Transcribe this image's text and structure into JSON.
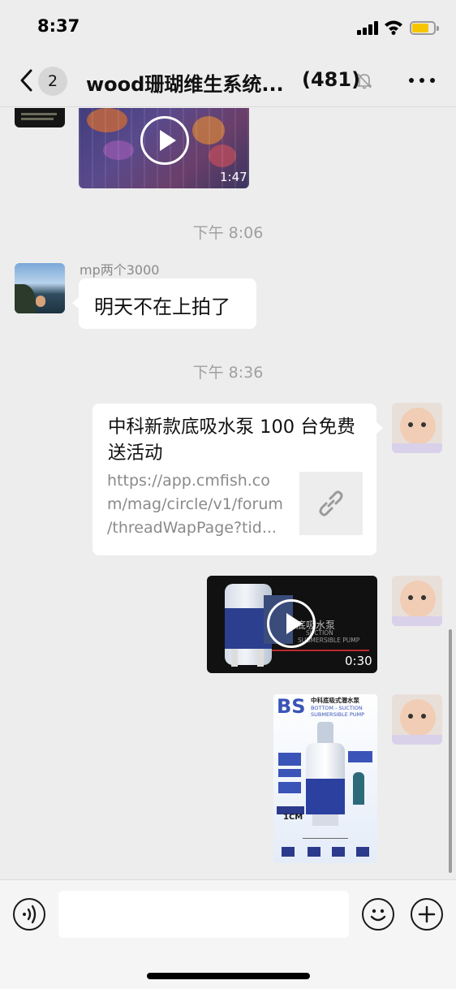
{
  "status_bar": {
    "time": "8:37"
  },
  "nav": {
    "unread_count": "2",
    "title": "wood珊瑚维生系统...",
    "member_count": "(481)"
  },
  "messages": {
    "video_top": {
      "duration": "1:47"
    },
    "timestamp_1": "下午 8:06",
    "msg_text": {
      "sender": "mp两个3000",
      "text": "明天不在上拍了"
    },
    "timestamp_2": "下午 8:36",
    "link_card": {
      "title": "中科新款底吸水泵 100 台免费送活动",
      "url_line1": "https://app.cmfish.co",
      "url_line2": "m/mag/circle/v1/forum",
      "url_line3": "/threadWapPage?tid..."
    },
    "video_pump": {
      "duration": "0:30",
      "overlay_cn": "底吸水泵",
      "overlay_en1": "SUCTION",
      "overlay_en2": "SUBMERSIBLE PUMP"
    },
    "image_pump": {
      "brand": "BS",
      "heading_cn": "中科底吸式潜水泵",
      "heading_en1": "BOTTOM - SUCTION",
      "heading_en2": "SUBMERSIBLE PUMP",
      "depth_label": "1CM"
    }
  },
  "input_bar": {
    "placeholder": ""
  },
  "colors": {
    "background": "#ededed",
    "bubble": "#ffffff",
    "battery": "#f7c500"
  }
}
